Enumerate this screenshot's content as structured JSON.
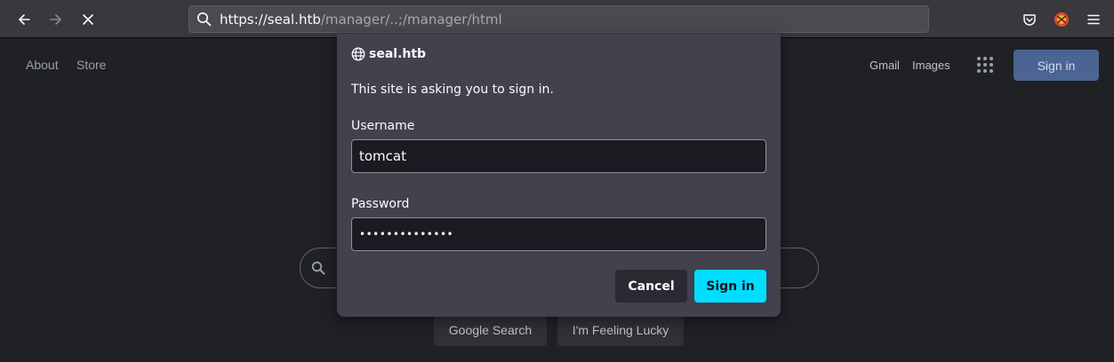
{
  "browser": {
    "url_host": "https://seal.htb",
    "url_path": "/manager/..;/manager/html"
  },
  "page": {
    "links": {
      "about": "About",
      "store": "Store",
      "gmail": "Gmail",
      "images": "Images"
    },
    "signin_label": "Sign in",
    "buttons": {
      "google_search": "Google Search",
      "feeling_lucky": "I'm Feeling Lucky"
    }
  },
  "dialog": {
    "host": "seal.htb",
    "message": "This site is asking you to sign in.",
    "username_label": "Username",
    "username_value": "tomcat",
    "password_label": "Password",
    "password_value": "••••••••••••••",
    "cancel_label": "Cancel",
    "signin_label": "Sign in"
  }
}
